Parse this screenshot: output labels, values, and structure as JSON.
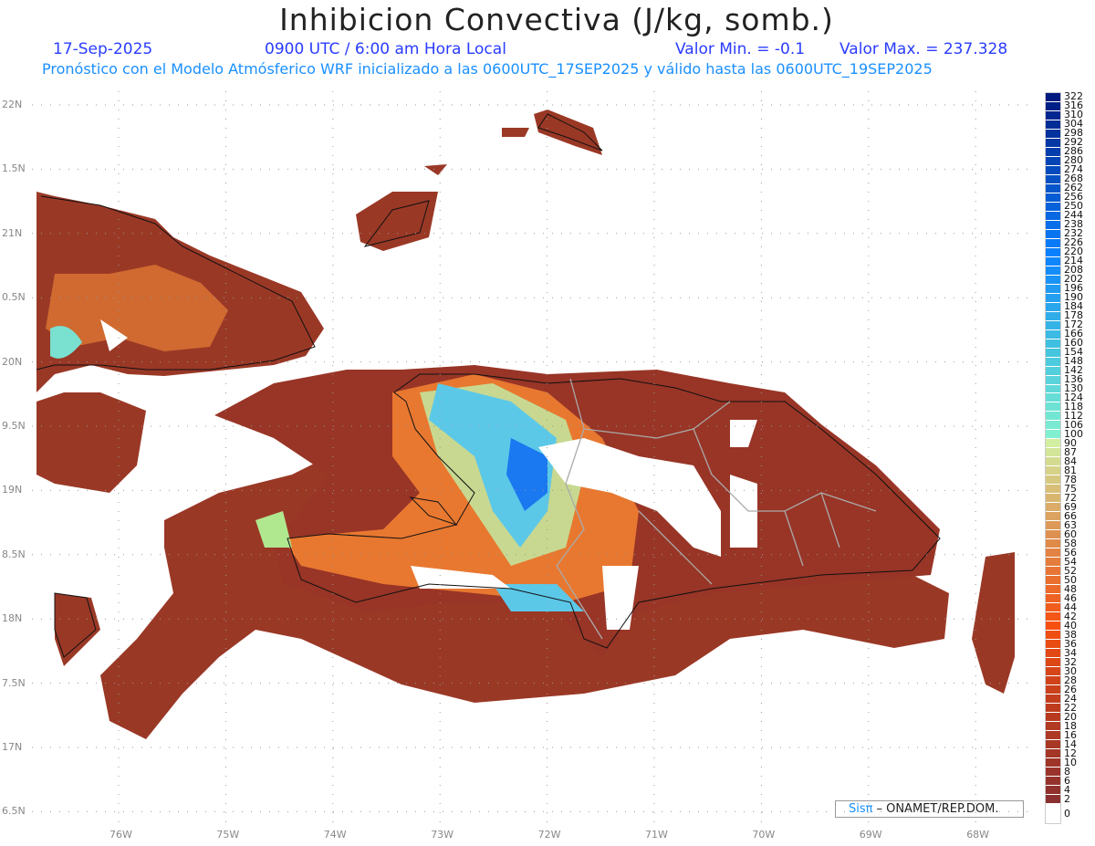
{
  "title": "Inhibicion Convectiva (J/kg, somb.)",
  "header": {
    "date": "17-Sep-2025",
    "time": "0900 UTC / 6:00 am Hora Local",
    "min_label": "Valor Min. = -0.1",
    "max_label": "Valor Max. = 237.328",
    "description": "Pronóstico con el Modelo Atmósferico WRF inicializado a las 0600UTC_17SEP2025 y válido hasta las  0600UTC_19SEP2025"
  },
  "axes": {
    "lon_labels": [
      "76W",
      "75W",
      "74W",
      "73W",
      "72W",
      "71W",
      "70W",
      "69W",
      "68W"
    ],
    "lat_labels": [
      "22N",
      "1.5N",
      "21N",
      "0.5N",
      "20N",
      "9.5N",
      "19N",
      "8.5N",
      "18N",
      "7.5N",
      "17N",
      "6.5N"
    ]
  },
  "colorbar": {
    "levels": [
      "322",
      "316",
      "310",
      "304",
      "298",
      "292",
      "286",
      "280",
      "274",
      "268",
      "262",
      "256",
      "250",
      "244",
      "238",
      "232",
      "226",
      "220",
      "214",
      "208",
      "202",
      "196",
      "190",
      "184",
      "178",
      "172",
      "166",
      "160",
      "154",
      "148",
      "142",
      "136",
      "130",
      "124",
      "118",
      "112",
      "106",
      "100",
      "90",
      "87",
      "84",
      "81",
      "78",
      "75",
      "72",
      "69",
      "66",
      "63",
      "60",
      "58",
      "56",
      "54",
      "52",
      "50",
      "48",
      "46",
      "44",
      "42",
      "40",
      "38",
      "36",
      "34",
      "32",
      "30",
      "28",
      "26",
      "24",
      "22",
      "20",
      "18",
      "16",
      "14",
      "12",
      "10",
      "8",
      "6",
      "4",
      "2",
      "0"
    ],
    "color_stops": [
      [
        0,
        "#ffffff"
      ],
      [
        2,
        "#8b3030"
      ],
      [
        20,
        "#b73a20"
      ],
      [
        40,
        "#f55010"
      ],
      [
        60,
        "#de9050"
      ],
      [
        90,
        "#d2eea0"
      ],
      [
        100,
        "#80f0d0"
      ],
      [
        160,
        "#40c0e0"
      ],
      [
        220,
        "#0a80ff"
      ],
      [
        322,
        "#001a80"
      ]
    ]
  },
  "credit": {
    "brand": "Sisπ",
    "text": "– ONAMET/REP.DOM."
  }
}
